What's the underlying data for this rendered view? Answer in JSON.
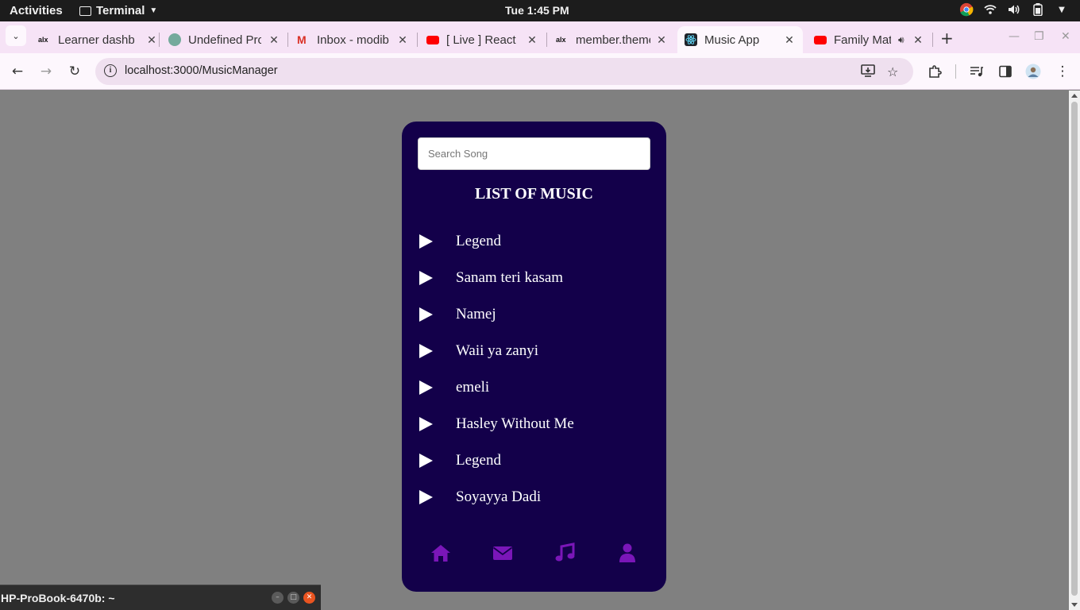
{
  "system_bar": {
    "activities": "Activities",
    "app_name": "Terminal",
    "clock": "Tue  1:45 PM"
  },
  "tabs": [
    {
      "title": "Learner dashb",
      "favicon_color": "#111111"
    },
    {
      "title": "Undefined Pro",
      "favicon_color": "#74aa9c"
    },
    {
      "title": "Inbox - modib",
      "favicon_color": "#d93025"
    },
    {
      "title": "[ Live ] React",
      "favicon_color": "#ff0000"
    },
    {
      "title": "member.theme",
      "favicon_color": "#111111"
    },
    {
      "title": "Music App",
      "favicon_color": "#61dafb"
    },
    {
      "title": "Family Mat",
      "favicon_color": "#ff0000"
    }
  ],
  "address_bar": {
    "url": "localhost:3000/MusicManager"
  },
  "music_app": {
    "search_placeholder": "Search Song",
    "list_title": "LIST OF MUSIC",
    "songs": [
      "Legend",
      "Sanam teri kasam",
      "Namej",
      "Waii ya zanyi",
      "emeli",
      "Hasley Without Me",
      "Legend",
      "Soyayya Dadi"
    ],
    "colors": {
      "card_bg": "#13004a",
      "nav_icon": "#7a16b8"
    }
  },
  "terminal_window": {
    "title": "HP-ProBook-6470b: ~"
  }
}
